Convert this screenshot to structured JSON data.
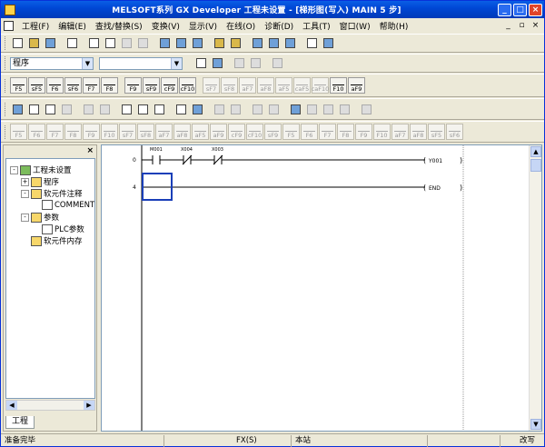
{
  "window": {
    "title": "MELSOFT系列 GX Developer 工程未设置 - [梯形图(写入)   MAIN   5 步]"
  },
  "menu": [
    "工程(F)",
    "编辑(E)",
    "查找/替换(S)",
    "变换(V)",
    "显示(V)",
    "在线(O)",
    "诊断(D)",
    "工具(T)",
    "窗口(W)",
    "帮助(H)"
  ],
  "toolbar": {
    "mode_select": "程序",
    "device_select": "",
    "fkeys_row1": [
      "F5",
      "sF5",
      "F6",
      "sF6",
      "F7",
      "F8",
      "F9",
      "sF9",
      "cF9",
      "cF10",
      "sF7",
      "sF8",
      "aF7",
      "aF8",
      "aF5",
      "caF5",
      "caF10",
      "F10",
      "aF9"
    ],
    "fkeys_row4": [
      "F5",
      "F6",
      "F7",
      "F8",
      "F9",
      "F10",
      "sF7",
      "sF8",
      "aF7",
      "aF8",
      "aF5",
      "aF9",
      "cF9",
      "cF10",
      "sF9",
      "F5",
      "F6",
      "F7",
      "F8",
      "F9",
      "F10",
      "aF7",
      "aF8",
      "sF5",
      "sF6",
      "cF5",
      "cF6"
    ]
  },
  "project_tree": {
    "close": "×",
    "items": [
      {
        "label": "工程未设置",
        "level": 0,
        "expander": "-"
      },
      {
        "label": "程序",
        "level": 1,
        "expander": "+"
      },
      {
        "label": "软元件注释",
        "level": 1,
        "expander": "-"
      },
      {
        "label": "COMMENT",
        "level": 2,
        "expander": ""
      },
      {
        "label": "参数",
        "level": 1,
        "expander": "-"
      },
      {
        "label": "PLC参数",
        "level": 2,
        "expander": ""
      },
      {
        "label": "软元件内存",
        "level": 1,
        "expander": ""
      }
    ],
    "tab": "工程"
  },
  "ladder": {
    "rungs": [
      {
        "step": "0",
        "contacts": [
          {
            "device": "M001",
            "type": "NO"
          },
          {
            "device": "X004",
            "type": "NC"
          },
          {
            "device": "X003",
            "type": "NC"
          }
        ],
        "coil": "Y001"
      },
      {
        "step": "4",
        "contacts": [],
        "coil": "END"
      }
    ]
  },
  "status": {
    "message": "准备完毕",
    "plc": "FX(S)",
    "station": "本站",
    "mode": "改写"
  }
}
